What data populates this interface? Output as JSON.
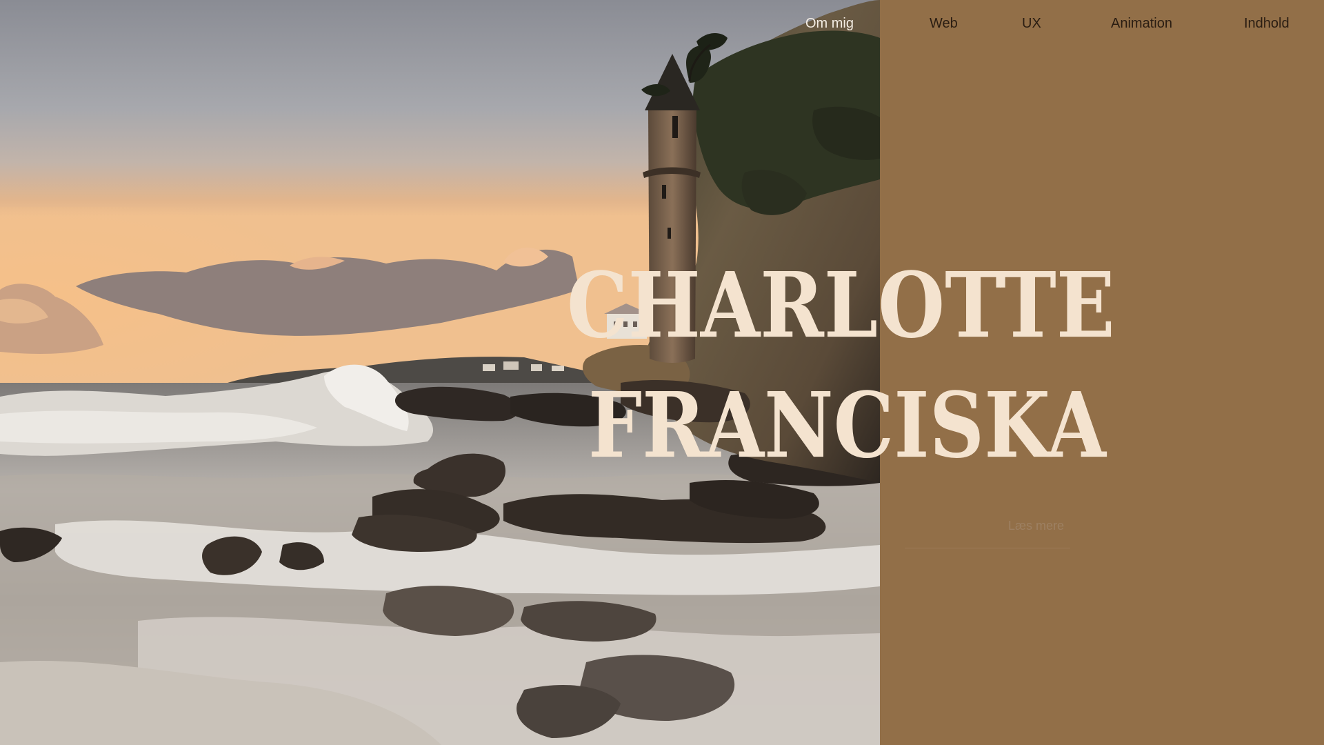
{
  "nav": {
    "items": [
      {
        "label": "Om mig",
        "active": true
      },
      {
        "label": "Web",
        "active": false
      },
      {
        "label": "UX",
        "active": false
      },
      {
        "label": "Animation",
        "active": false
      },
      {
        "label": "Indhold",
        "active": false
      }
    ]
  },
  "hero": {
    "name_line_1": "CHARLOTTE",
    "name_line_2": "FRANCISKA",
    "read_more_label": "Læs mere"
  },
  "colors": {
    "panel": "#926f48",
    "name_text": "#f4e3cf",
    "nav_active": "#f4ede4",
    "nav_text": "#2a1d12"
  }
}
